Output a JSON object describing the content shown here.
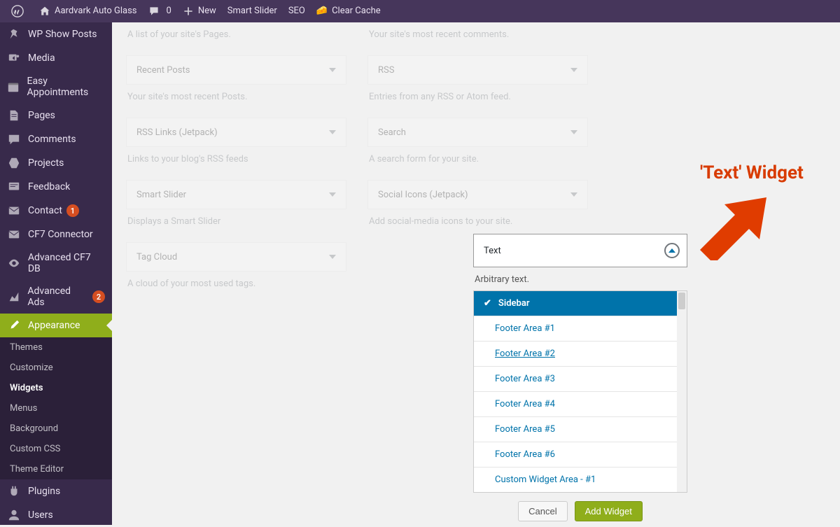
{
  "toolbar": {
    "site": "Aardvark Auto Glass",
    "comments": "0",
    "new": "New",
    "smart_slider": "Smart Slider",
    "seo": "SEO",
    "clear_cache": "Clear Cache"
  },
  "sidebar": {
    "items": [
      {
        "label": "WP Show Posts"
      },
      {
        "label": "Media"
      },
      {
        "label": "Easy Appointments"
      },
      {
        "label": "Pages"
      },
      {
        "label": "Comments"
      },
      {
        "label": "Projects"
      },
      {
        "label": "Feedback"
      },
      {
        "label": "Contact",
        "badge": "1"
      },
      {
        "label": "CF7 Connector"
      },
      {
        "label": "Advanced CF7 DB"
      },
      {
        "label": "Advanced Ads",
        "badge": "2"
      },
      {
        "label": "Appearance",
        "current": true
      }
    ],
    "submenu": [
      "Themes",
      "Customize",
      "Widgets",
      "Menus",
      "Background",
      "Custom CSS",
      "Theme Editor"
    ],
    "submenu_active": "Widgets",
    "after": [
      {
        "label": "Plugins"
      },
      {
        "label": "Users"
      }
    ]
  },
  "widgets": {
    "left": [
      {
        "title": "",
        "desc": "A list of your site's Pages."
      },
      {
        "title": "Recent Posts",
        "desc": "Your site's most recent Posts."
      },
      {
        "title": "RSS Links (Jetpack)",
        "desc": "Links to your blog's RSS feeds"
      },
      {
        "title": "Smart Slider",
        "desc": "Displays a Smart Slider"
      },
      {
        "title": "Tag Cloud",
        "desc": "A cloud of your most used tags."
      }
    ],
    "right": [
      {
        "title": "",
        "desc": "Your site's most recent comments."
      },
      {
        "title": "RSS",
        "desc": "Entries from any RSS or Atom feed."
      },
      {
        "title": "Search",
        "desc": "A search form for your site."
      },
      {
        "title": "Social Icons (Jetpack)",
        "desc": "Add social-media icons to your site."
      }
    ]
  },
  "text_widget": {
    "title": "Text",
    "desc": "Arbitrary text.",
    "areas": [
      "Sidebar",
      "Footer Area #1",
      "Footer Area #2",
      "Footer Area #3",
      "Footer Area #4",
      "Footer Area #5",
      "Footer Area #6",
      "Custom Widget Area - #1"
    ],
    "selected_area": "Sidebar",
    "underline_area": "Footer Area #2",
    "cancel": "Cancel",
    "add": "Add Widget"
  },
  "annotation": "'Text' Widget"
}
